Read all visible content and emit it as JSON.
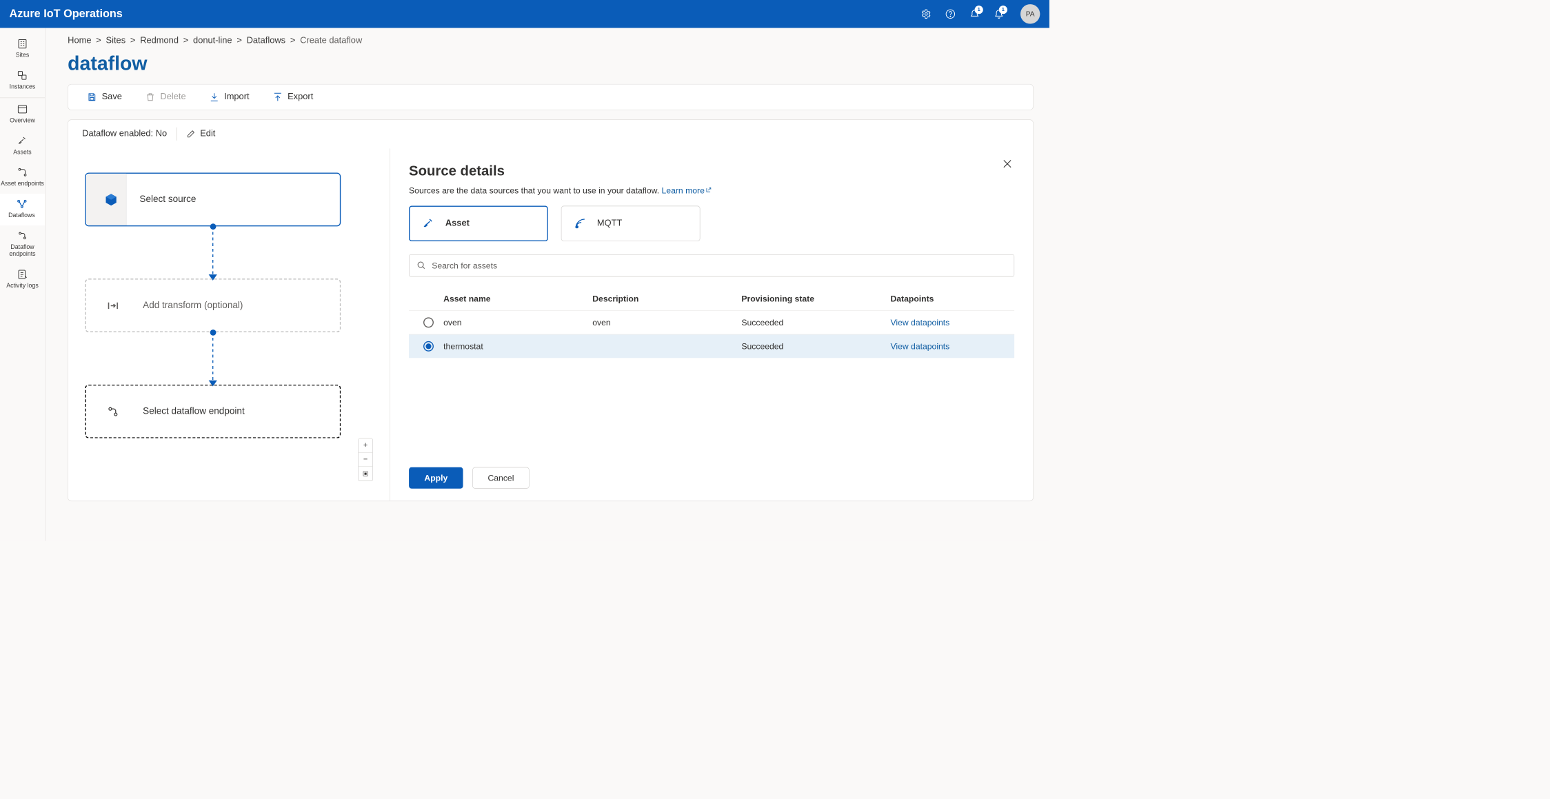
{
  "brand": "Azure IoT Operations",
  "notifications": {
    "count1": "1",
    "count2": "1"
  },
  "avatar": "PA",
  "sidenav": {
    "items": [
      {
        "label": "Sites"
      },
      {
        "label": "Instances"
      },
      {
        "label": "Overview"
      },
      {
        "label": "Assets"
      },
      {
        "label": "Asset endpoints"
      },
      {
        "label": "Dataflows"
      },
      {
        "label": "Dataflow endpoints"
      },
      {
        "label": "Activity logs"
      }
    ]
  },
  "breadcrumb": {
    "items": [
      "Home",
      "Sites",
      "Redmond",
      "donut-line",
      "Dataflows"
    ],
    "current": "Create dataflow"
  },
  "page_title": "dataflow",
  "toolbar": {
    "save": "Save",
    "delete": "Delete",
    "import": "Import",
    "export": "Export"
  },
  "dataflow_status": {
    "label": "Dataflow enabled: ",
    "value": "No",
    "edit": "Edit"
  },
  "canvas": {
    "source": "Select source",
    "transform": "Add transform (optional)",
    "endpoint": "Select dataflow endpoint",
    "zoom": {
      "plus": "+",
      "minus": "−",
      "fit": "⛶"
    }
  },
  "details": {
    "title": "Source details",
    "desc": "Sources are the data sources that you want to use in your dataflow. ",
    "learn": "Learn more",
    "tabs": {
      "asset": "Asset",
      "mqtt": "MQTT"
    },
    "search_placeholder": "Search for assets",
    "columns": {
      "name": "Asset name",
      "desc": "Description",
      "state": "Provisioning state",
      "dp": "Datapoints"
    },
    "rows": [
      {
        "name": "oven",
        "desc": "oven",
        "state": "Succeeded",
        "link": "View datapoints"
      },
      {
        "name": "thermostat",
        "desc": "",
        "state": "Succeeded",
        "link": "View datapoints"
      }
    ],
    "apply": "Apply",
    "cancel": "Cancel"
  }
}
